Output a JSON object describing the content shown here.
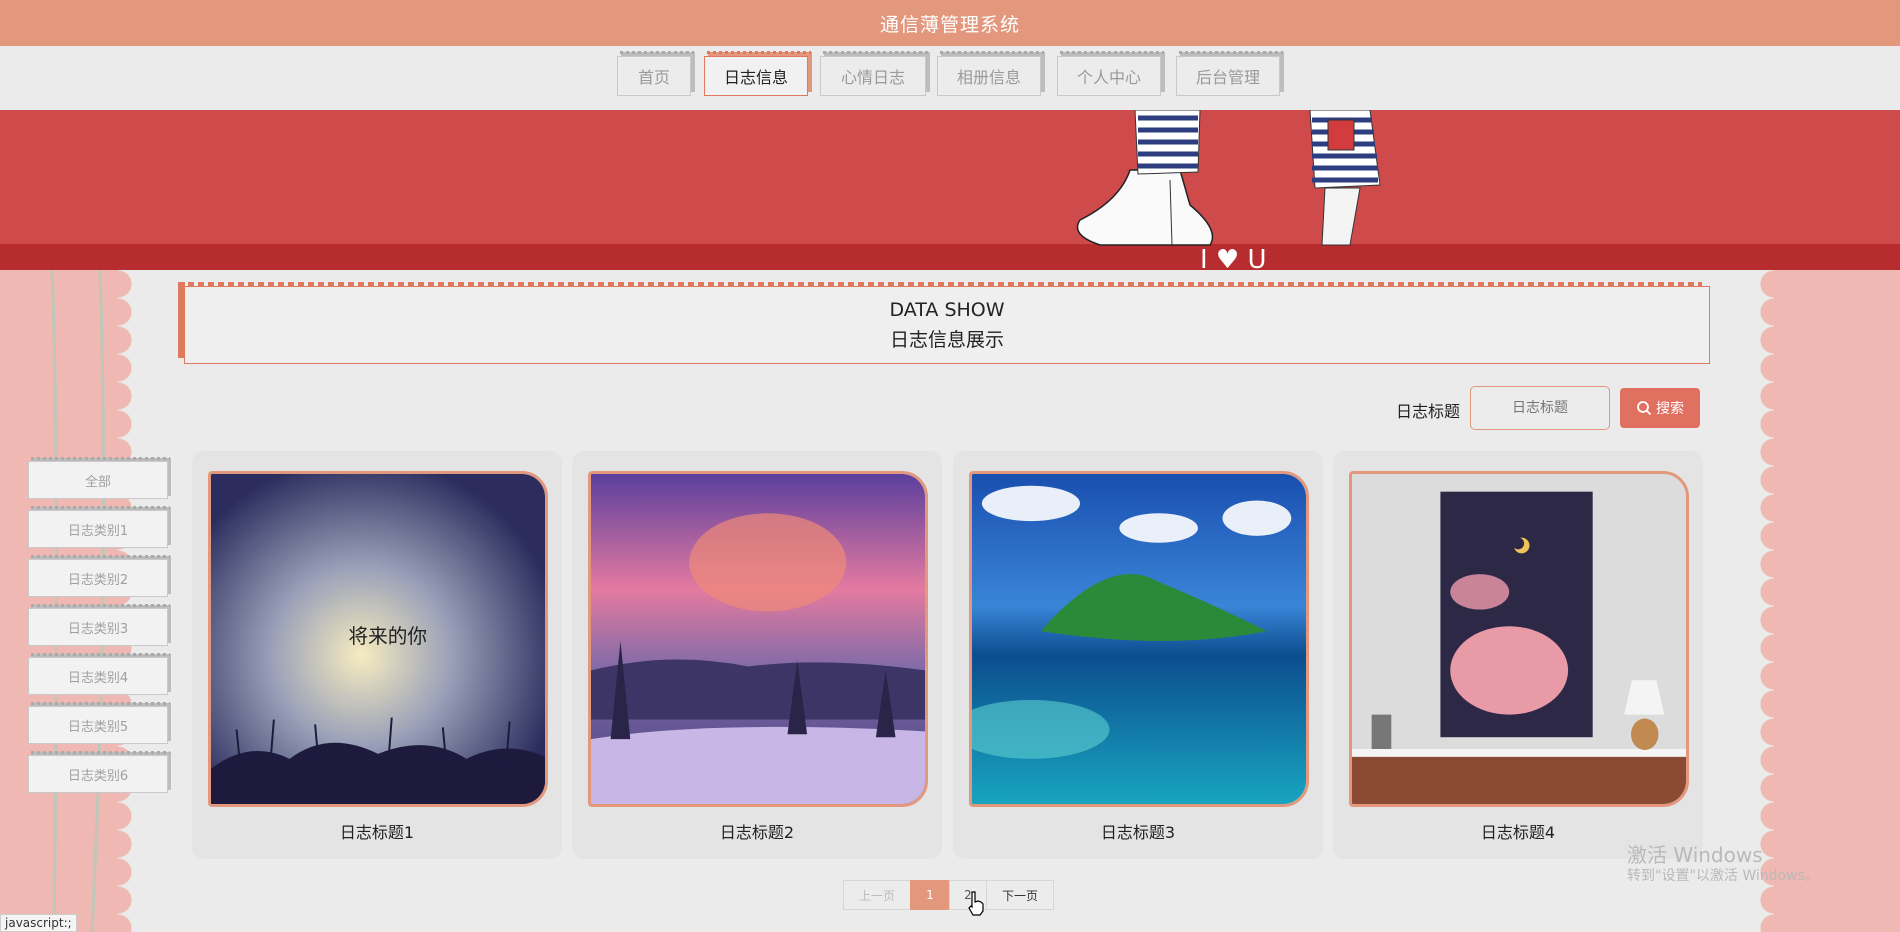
{
  "app": {
    "title": "通信薄管理系统"
  },
  "nav": {
    "items": [
      {
        "label": "首页"
      },
      {
        "label": "日志信息"
      },
      {
        "label": "心情日志"
      },
      {
        "label": "相册信息"
      },
      {
        "label": "个人中心"
      },
      {
        "label": "后台管理"
      }
    ],
    "active": "日志信息"
  },
  "banner": {
    "text": "I ♥ U"
  },
  "heading": {
    "en": "DATA SHOW",
    "cn": "日志信息展示"
  },
  "search": {
    "label": "日志标题",
    "placeholder": "日志标题",
    "button_label": "搜索"
  },
  "categories": [
    "全部",
    "日志类别1",
    "日志类别2",
    "日志类别3",
    "日志类别4",
    "日志类别5",
    "日志类别6"
  ],
  "cards": [
    {
      "title": "日志标题1",
      "image_text": "将来的你"
    },
    {
      "title": "日志标题2"
    },
    {
      "title": "日志标题3"
    },
    {
      "title": "日志标题4"
    }
  ],
  "pagination": {
    "prev_label": "上一页",
    "pages": [
      "1",
      "2"
    ],
    "current": "1",
    "next_label": "下一页"
  },
  "watermark": {
    "line1": "激活 Windows",
    "line2": "转到\"设置\"以激活 Windows。"
  },
  "statusbar": {
    "text": "javascript:;"
  },
  "colors": {
    "accent": "#e3987e",
    "banner": "#cf4a4b",
    "button": "#e07060"
  }
}
